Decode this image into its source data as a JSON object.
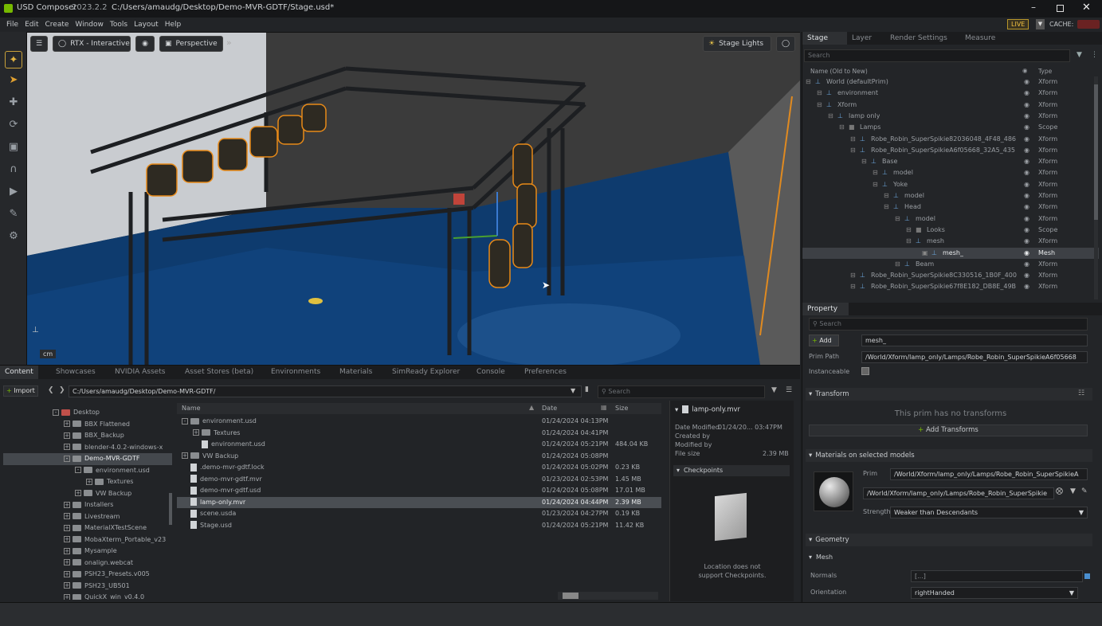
{
  "app": {
    "name": "USD Composer",
    "version": "2023.2.2",
    "path": "C:/Users/amaudg/Desktop/Demo-MVR-GDTF/Stage.usd*"
  },
  "menu": [
    "File",
    "Edit",
    "Create",
    "Window",
    "Tools",
    "Layout",
    "Help"
  ],
  "topright": {
    "live": "LIVE",
    "cache": "CACHE:"
  },
  "viewport": {
    "renderer": "RTX - Interactive",
    "camera": "Perspective",
    "lights": "Stage Lights",
    "units": "cm"
  },
  "stage": {
    "tabs": [
      "Stage",
      "Layer",
      "Render Settings",
      "Measure"
    ],
    "search_placeholder": "Search",
    "col_name": "Name (Old to New)",
    "col_type": "Type",
    "rows": [
      {
        "name": "World (defaultPrim)",
        "type": "Xform"
      },
      {
        "name": "environment",
        "type": "Xform"
      },
      {
        "name": "Xform",
        "type": "Xform"
      },
      {
        "name": "lamp only",
        "type": "Xform"
      },
      {
        "name": "Lamps",
        "type": "Scope"
      },
      {
        "name": "Robe_Robin_SuperSpikie82036048_4F48_486",
        "type": "Xform"
      },
      {
        "name": "Robe_Robin_SuperSpikieA6f05668_32A5_435",
        "type": "Xform"
      },
      {
        "name": "Base",
        "type": "Xform"
      },
      {
        "name": "model",
        "type": "Xform"
      },
      {
        "name": "Yoke",
        "type": "Xform"
      },
      {
        "name": "model",
        "type": "Xform"
      },
      {
        "name": "Head",
        "type": "Xform"
      },
      {
        "name": "model",
        "type": "Xform"
      },
      {
        "name": "Looks",
        "type": "Scope"
      },
      {
        "name": "mesh",
        "type": "Xform"
      },
      {
        "name": "mesh_",
        "type": "Mesh"
      },
      {
        "name": "Beam",
        "type": "Xform"
      },
      {
        "name": "Robe_Robin_SuperSpikie8C330516_1B0F_400",
        "type": "Xform"
      },
      {
        "name": "Robe_Robin_SuperSpikie67f8E182_DB8E_49B",
        "type": "Xform"
      }
    ]
  },
  "property": {
    "tab": "Property",
    "search_placeholder": "Search",
    "add_label": "Add",
    "prim_name": "mesh_",
    "prim_path_label": "Prim Path",
    "prim_path": "/World/Xform/lamp_only/Lamps/Robe_Robin_SuperSpikieA6f05668",
    "instanceable_label": "Instanceable",
    "transform_header": "Transform",
    "no_transforms": "This prim has no transforms",
    "add_transforms": "Add Transforms",
    "materials_header": "Materials on selected models",
    "prim_label": "Prim",
    "material_prim": "/World/Xform/lamp_only/Lamps/Robe_Robin_SuperSpikieA",
    "material_path": "/World/Xform/lamp_only/Lamps/Robe_Robin_SuperSpikie",
    "strength_label": "Strength",
    "strength_value": "Weaker than Descendants",
    "geometry_header": "Geometry",
    "mesh_header": "Mesh",
    "normals_label": "Normals",
    "normals_value": "[...]",
    "orientation_label": "Orientation",
    "orientation_value": "rightHanded"
  },
  "content": {
    "tabs": [
      "Content",
      "Showcases",
      "NVIDIA Assets",
      "Asset Stores (beta)",
      "Environments",
      "Materials",
      "SimReady Explorer",
      "Console",
      "Preferences"
    ],
    "import_label": "Import",
    "path": "C:/Users/amaudg/Desktop/Demo-MVR-GDTF/",
    "search_placeholder": "Search",
    "folder_tree": [
      {
        "name": "Desktop",
        "level": 0
      },
      {
        "name": "BBX Flattened",
        "level": 1
      },
      {
        "name": "BBX_Backup",
        "level": 1
      },
      {
        "name": "blender-4.0.2-windows-x",
        "level": 1
      },
      {
        "name": "Demo-MVR-GDTF",
        "level": 1
      },
      {
        "name": "environment.usd",
        "level": 2
      },
      {
        "name": "Textures",
        "level": 3
      },
      {
        "name": "VW Backup",
        "level": 2
      },
      {
        "name": "Installers",
        "level": 1
      },
      {
        "name": "Livestream",
        "level": 1
      },
      {
        "name": "MaterialXTestScene",
        "level": 1
      },
      {
        "name": "MobaXterm_Portable_v23",
        "level": 1
      },
      {
        "name": "Mysample",
        "level": 1
      },
      {
        "name": "onalign.webcat",
        "level": 1
      },
      {
        "name": "PSH23_Presets.v005",
        "level": 1
      },
      {
        "name": "PSH23_UB501",
        "level": 1
      },
      {
        "name": "QuickX_win_v0.4.0",
        "level": 1
      }
    ],
    "columns": {
      "name": "Name",
      "date": "Date",
      "size": "Size"
    },
    "files": [
      {
        "name": "environment.usd",
        "date": "01/24/2024 04:13PM",
        "size": "",
        "kind": "folder",
        "level": 0
      },
      {
        "name": "Textures",
        "date": "01/24/2024 04:41PM",
        "size": "",
        "kind": "folder",
        "level": 1
      },
      {
        "name": "environment.usd",
        "date": "01/24/2024 05:21PM",
        "size": "484.04 KB",
        "kind": "file",
        "level": 1
      },
      {
        "name": "VW Backup",
        "date": "01/24/2024 05:08PM",
        "size": "",
        "kind": "folder",
        "level": 0
      },
      {
        "name": ".demo-mvr-gdtf.lock",
        "date": "01/24/2024 05:02PM",
        "size": "0.23 KB",
        "kind": "file",
        "level": 0
      },
      {
        "name": "demo-mvr-gdtf.mvr",
        "date": "01/23/2024 02:53PM",
        "size": "1.45 MB",
        "kind": "file",
        "level": 0
      },
      {
        "name": "demo-mvr-gdtf.usd",
        "date": "01/24/2024 05:08PM",
        "size": "17.01 MB",
        "kind": "file",
        "level": 0
      },
      {
        "name": "lamp-only.mvr",
        "date": "01/24/2024 04:44PM",
        "size": "2.39 MB",
        "kind": "file",
        "level": 0
      },
      {
        "name": "scene.usda",
        "date": "01/23/2024 04:27PM",
        "size": "0.19 KB",
        "kind": "file",
        "level": 0
      },
      {
        "name": "Stage.usd",
        "date": "01/24/2024 05:21PM",
        "size": "11.42 KB",
        "kind": "file",
        "level": 0
      }
    ],
    "details": {
      "filename": "lamp-only.mvr",
      "modified_label": "Date Modified",
      "modified_value": "01/24/20... 03:47PM",
      "created_by": "Created by",
      "modified_by": "Modified by",
      "size_label": "File size",
      "size_value": "2.39 MB",
      "checkpoints_header": "Checkpoints",
      "checkpoint_msg_1": "Location does not",
      "checkpoint_msg_2": "support Checkpoints."
    }
  }
}
